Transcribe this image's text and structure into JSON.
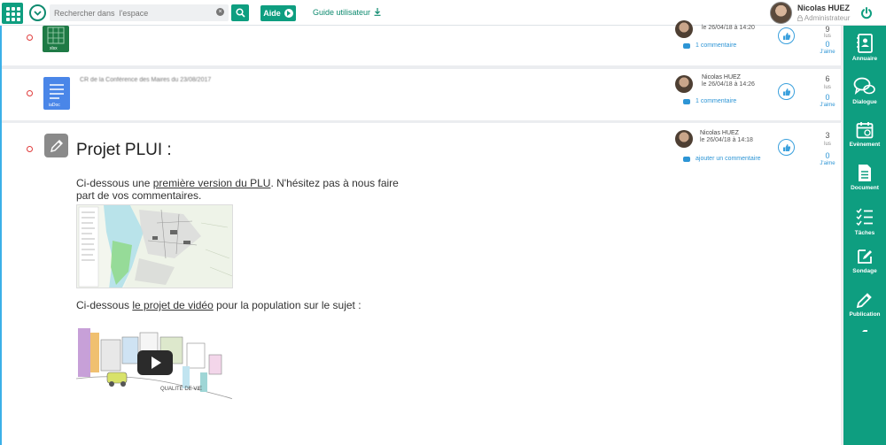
{
  "topbar": {
    "search_placeholder": "Rechercher dans  l'espace",
    "aide_label": "Aide",
    "guide_label": "Guide utilisateur",
    "user_name": "Nicolas HUEZ",
    "user_role": "Administrateur"
  },
  "posts": [
    {
      "title": "",
      "author": "",
      "date": "le 26/04/18 à 14:20",
      "comment_link": "1 commentaire",
      "views": "9",
      "views_label": "lus",
      "likes": "0",
      "likes_label": "J'aime"
    },
    {
      "title": "CR de la Conférence des Maires du 23/08/2017",
      "author": "Nicolas HUEZ",
      "date": "le 26/04/18 à 14:26",
      "comment_link": "1 commentaire",
      "views": "6",
      "views_label": "lus",
      "likes": "0",
      "likes_label": "J'aime"
    },
    {
      "title": "Projet PLUI :",
      "author": "Nicolas HUEZ",
      "date": "le 26/04/18 à 14:18",
      "comment_link": "ajouter un commentaire",
      "views": "3",
      "views_label": "lus",
      "likes": "0",
      "likes_label": "J'aime",
      "body_line1_pre": "Ci-dessous une ",
      "body_line1_link": "première version du PLU",
      "body_line1_post": ". N'hésitez pas à nous faire",
      "body_line2": "part de vos commentaires.",
      "video_pre": "Ci-dessous ",
      "video_link": "le projet de vidéo",
      "video_post": " pour la population sur le sujet :"
    }
  ],
  "rightbar": {
    "items": [
      {
        "label": "Annuaire",
        "icon": "address-book-icon"
      },
      {
        "label": "Dialogue",
        "icon": "chat-bubbles-icon"
      },
      {
        "label": "Evènement",
        "icon": "calendar-icon"
      },
      {
        "label": "Document",
        "icon": "document-icon"
      },
      {
        "label": "Tâches",
        "icon": "checklist-icon"
      },
      {
        "label": "Sondage",
        "icon": "poll-edit-icon"
      },
      {
        "label": "Publication",
        "icon": "pencil-icon"
      }
    ]
  },
  "colors": {
    "brand": "#0e9e80",
    "link": "#2d95d5",
    "unread_dot": "#e03c3c"
  }
}
